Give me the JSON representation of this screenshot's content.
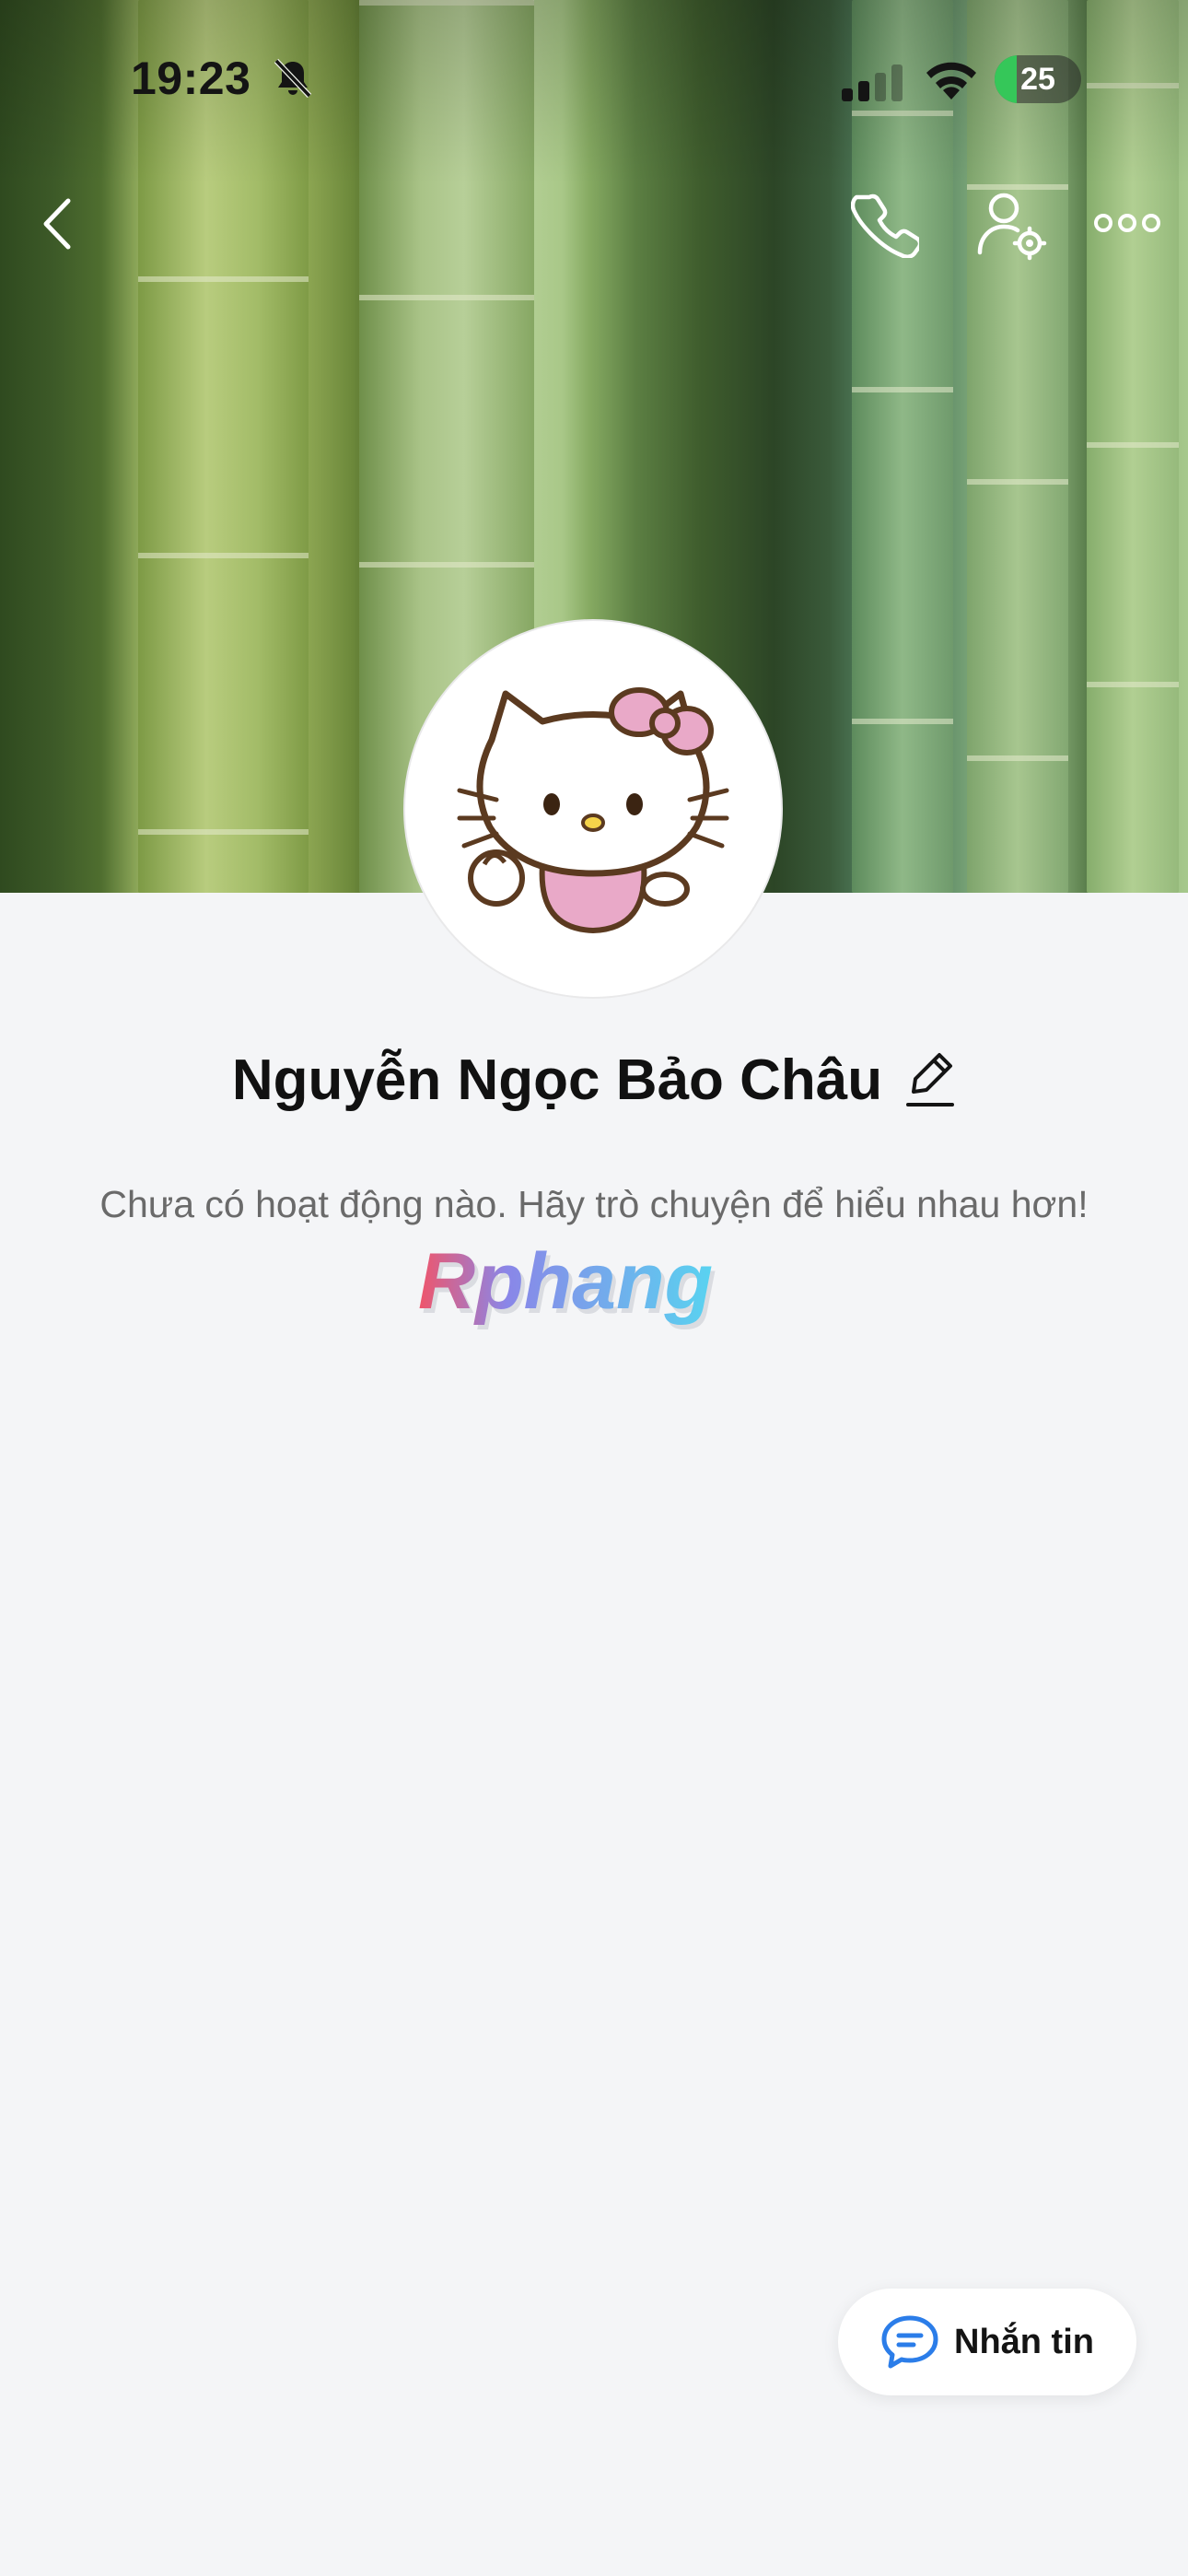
{
  "status_bar": {
    "time": "19:23",
    "battery": "25"
  },
  "header": {
    "back_icon": "chevron-left-icon",
    "call_icon": "phone-icon",
    "settings_icon": "user-settings-icon",
    "more_icon": "more-horizontal-icon"
  },
  "profile": {
    "name": "Nguyễn Ngọc Bảo Châu",
    "empty_message": "Chưa có hoạt động nào. Hãy trò chuyện để hiểu nhau hơn!",
    "avatar_icon": "hello-kitty-avatar"
  },
  "watermark": {
    "text": "Rphang"
  },
  "message_button": {
    "label": "Nhắn tin",
    "icon": "chat-bubble-icon"
  },
  "colors": {
    "accent_blue": "#2b7de9",
    "background": "#f4f5f7",
    "battery_green": "#35c759"
  }
}
